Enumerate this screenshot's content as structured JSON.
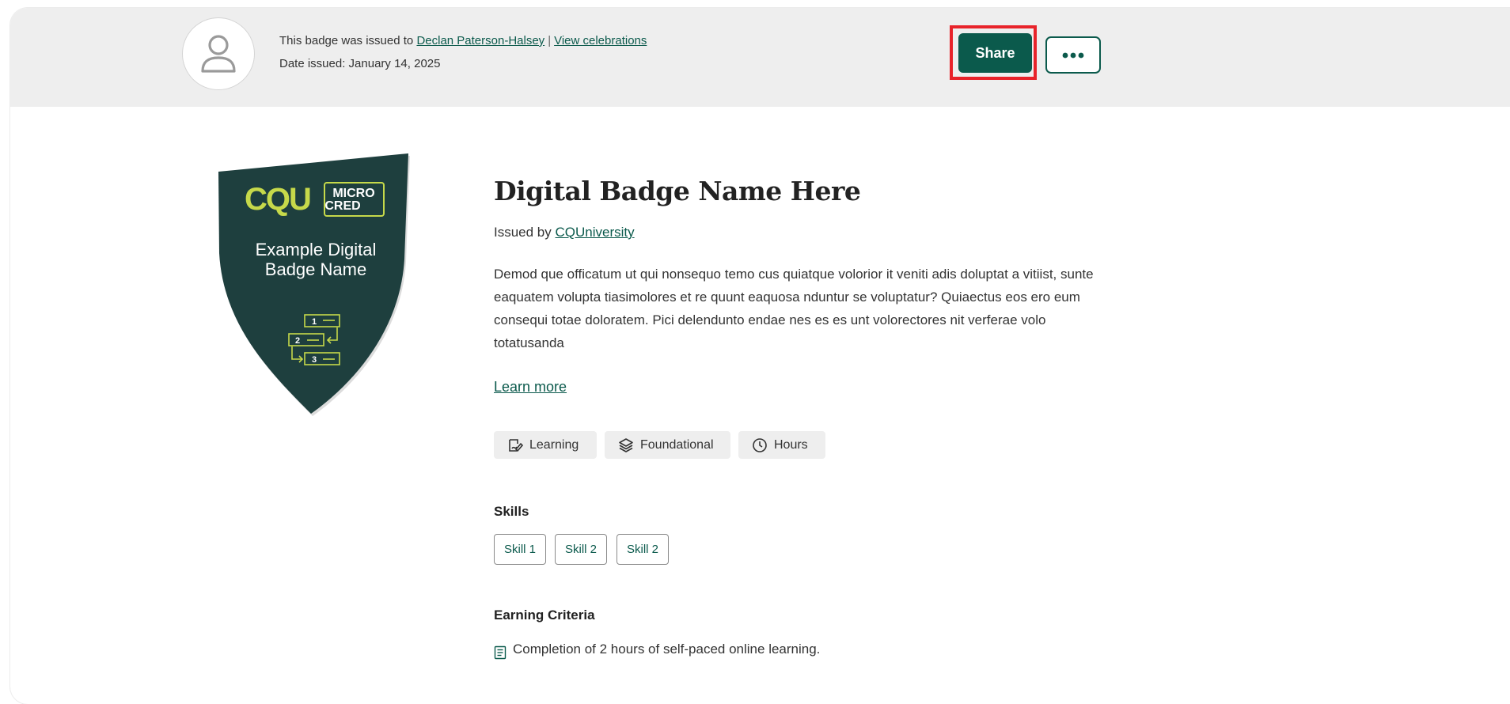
{
  "header": {
    "issued_prefix": "This badge was issued to",
    "recipient_name": "Declan Paterson-Halsey",
    "separator": "|",
    "view_celebrations": "View celebrations",
    "date_issued": "Date issued: January 14, 2025",
    "share_label": "Share",
    "more_icon": "ellipsis-icon",
    "avatar_icon": "user-icon"
  },
  "badge_image": {
    "brand": "CQU",
    "tag_line1": "MICRO",
    "tag_line2": "CRED",
    "name_line1": "Example Digital",
    "name_line2": "Badge Name",
    "step1": "1",
    "step2": "2",
    "step3": "3",
    "shield_color": "#1e3f3e",
    "accent_color": "#c6d94a",
    "text_color": "#ffffff"
  },
  "badge": {
    "title": "Digital Badge Name Here",
    "issued_by_prefix": "Issued by",
    "issuer": "CQUniversity",
    "description": "Demod que officatum ut qui nonsequo temo cus quiatque volorior it veniti adis doluptat a vitiist, sunte eaquatem volupta tiasimolores et re quunt eaquosa nduntur se voluptatur? Quiaectus eos ero eum consequi totae doloratem. Pici delendunto endae nes es es unt volorectores nit verferae volo totatusanda",
    "learn_more": "Learn more"
  },
  "tags": [
    {
      "label": "Learning",
      "icon": "learning-icon"
    },
    {
      "label": "Foundational",
      "icon": "layers-icon"
    },
    {
      "label": "Hours",
      "icon": "clock-icon"
    }
  ],
  "skills": {
    "title": "Skills",
    "items": [
      "Skill 1",
      "Skill 2",
      "Skill 2"
    ]
  },
  "earning_criteria": {
    "title": "Earning Criteria",
    "items": [
      {
        "icon": "document-icon",
        "text": "Completion of 2 hours of self-paced online learning."
      }
    ]
  },
  "colors": {
    "brand_green": "#0b5a4c",
    "highlight": "#e8232a",
    "topbar_bg": "#eeeeee"
  }
}
